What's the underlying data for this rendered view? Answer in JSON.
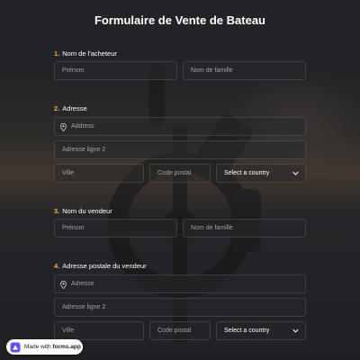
{
  "form": {
    "title": "Formulaire de Vente de Bateau"
  },
  "questions": {
    "q1": {
      "number": "1.",
      "label": "Nom de l'acheteur",
      "first_name_placeholder": "Prénom",
      "last_name_placeholder": "Nom de famille"
    },
    "q2": {
      "number": "2.",
      "label": "Adresse",
      "address_placeholder": "Address",
      "address2_placeholder": "Adresse ligne 2",
      "city_placeholder": "Ville",
      "postal_placeholder": "Code postal",
      "country_value": "Select a country"
    },
    "q3": {
      "number": "3.",
      "label": "Nom du vendeur",
      "first_name_placeholder": "Prénom",
      "last_name_placeholder": "Nom de famille"
    },
    "q4": {
      "number": "4.",
      "label": "Adresse postale du vendeur",
      "address_placeholder": "Adresse",
      "address2_placeholder": "Adresse ligne 2",
      "city_placeholder": "Ville",
      "postal_placeholder": "Code postal",
      "country_value": "Select a country"
    }
  },
  "badge": {
    "prefix": "Made with",
    "brand": "forms.app"
  },
  "colors": {
    "accent_number": "#f0b429",
    "brand_icon": "#6c4cf0"
  }
}
